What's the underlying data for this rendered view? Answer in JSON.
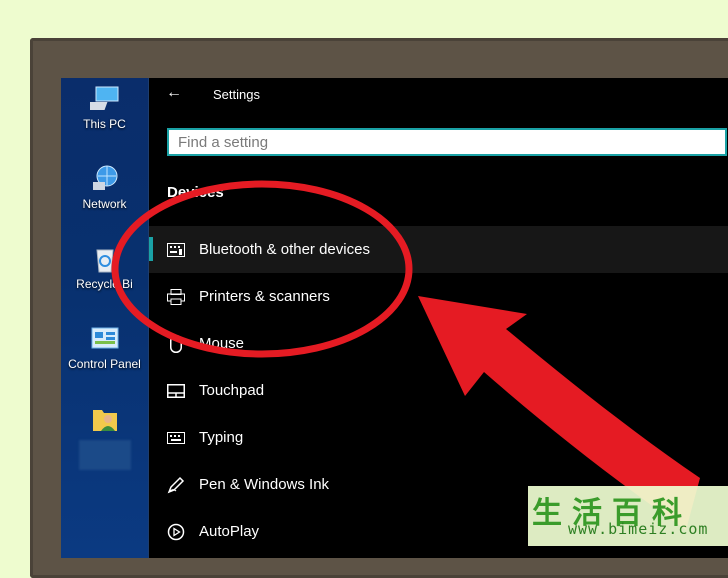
{
  "desktop": {
    "icons": [
      {
        "name": "this-pc-icon",
        "label": "This PC"
      },
      {
        "name": "network-icon",
        "label": "Network"
      },
      {
        "name": "recycle-bin-icon",
        "label": "Recycle Bi"
      },
      {
        "name": "control-panel-icon",
        "label": "Control Panel"
      },
      {
        "name": "user-folder-icon",
        "label": ""
      }
    ]
  },
  "settings": {
    "title": "Settings",
    "search_placeholder": "Find a setting",
    "section": "Devices",
    "nav": [
      {
        "name": "bluetooth-icon",
        "label": "Bluetooth & other devices",
        "active": true
      },
      {
        "name": "printer-icon",
        "label": "Printers & scanners"
      },
      {
        "name": "mouse-icon",
        "label": "Mouse"
      },
      {
        "name": "touchpad-icon",
        "label": "Touchpad"
      },
      {
        "name": "keyboard-icon",
        "label": "Typing"
      },
      {
        "name": "pen-icon",
        "label": "Pen & Windows Ink"
      },
      {
        "name": "autoplay-icon",
        "label": "AutoPlay"
      }
    ]
  },
  "annotation": {
    "color": "#e51b23"
  },
  "watermark": {
    "chinese": "生活百科",
    "url": "www.bimeiz.com"
  }
}
